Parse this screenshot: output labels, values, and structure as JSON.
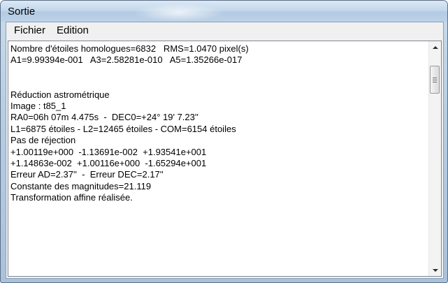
{
  "window": {
    "title": "Sortie"
  },
  "menu": {
    "items": [
      "Fichier",
      "Edition"
    ]
  },
  "output": {
    "lines": [
      "Nombre d'étoiles homologues=6832   RMS=1.0470 pixel(s)",
      "A1=9.99394e-001   A3=2.58281e-010   A5=1.35266e-017",
      "",
      "",
      "Réduction astrométrique",
      "Image : t85_1",
      "RA0=06h 07m 4.475s  -  DEC0=+24° 19' 7.23''",
      "L1=6875 étoiles - L2=12465 étoiles - COM=6154 étoiles",
      "Pas de réjection",
      "+1.00119e+000  -1.13691e-002  +1.93541e+001",
      "+1.14863e-002  +1.00116e+000  -1.65294e+001",
      "Erreur AD=2.37''  -  Erreur DEC=2.17''",
      "Constante des magnitudes=21.119",
      "Transformation affine réalisée."
    ]
  }
}
